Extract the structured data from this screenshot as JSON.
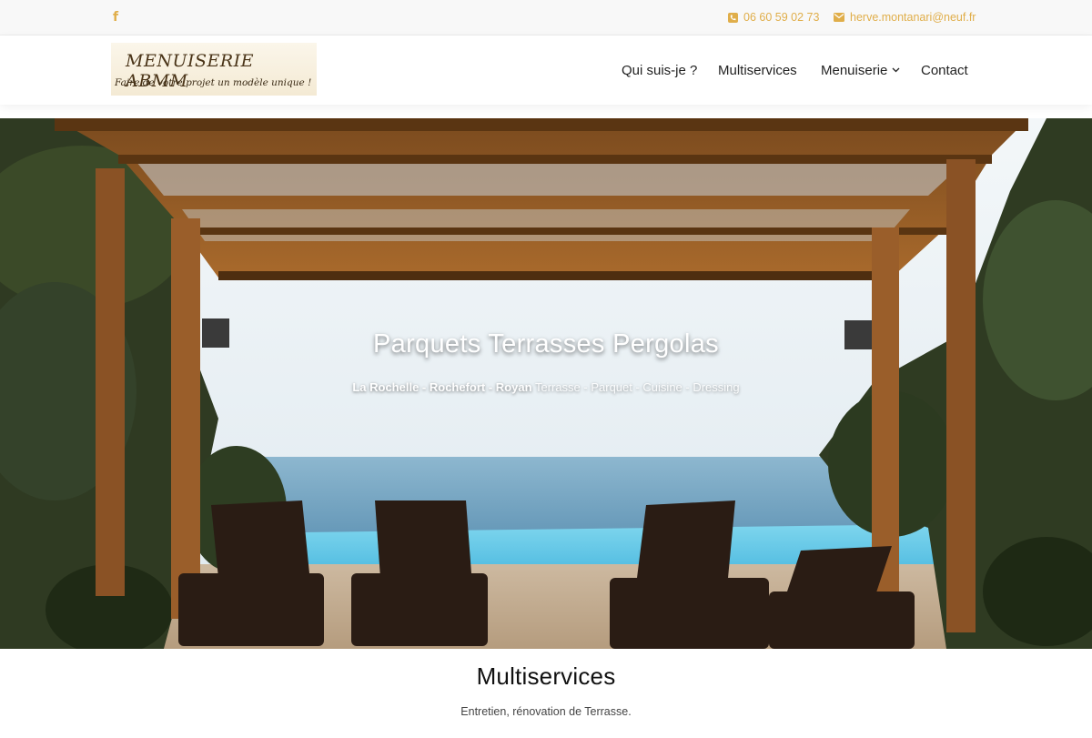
{
  "topbar": {
    "facebook_icon": "facebook-icon",
    "phone_icon": "phone-icon",
    "phone": "06 60 59 02 73",
    "mail_icon": "envelope-icon",
    "email": "herve.montanari@neuf.fr",
    "accent_color": "#e0ae4a"
  },
  "header": {
    "logo": {
      "brand": "MENUISERIE ABMM",
      "tagline": "Faire de votre projet un modèle unique !"
    },
    "nav": [
      {
        "label": "Qui suis-je ?"
      },
      {
        "label": "Multiservices"
      },
      {
        "label": "Menuiserie",
        "has_dropdown": true,
        "icon": "chevron-down-icon"
      },
      {
        "label": "Contact"
      }
    ]
  },
  "hero": {
    "title": "Parquets Terrasses Pergolas",
    "subtitle_cities": "La Rochelle - Rochefort - Royan",
    "subtitle_services": "Terrasse - Parquet - Cuisine - Dressing"
  },
  "section": {
    "title": "Multiservices",
    "subtitle": "Entretien, rénovation de Terrasse."
  }
}
